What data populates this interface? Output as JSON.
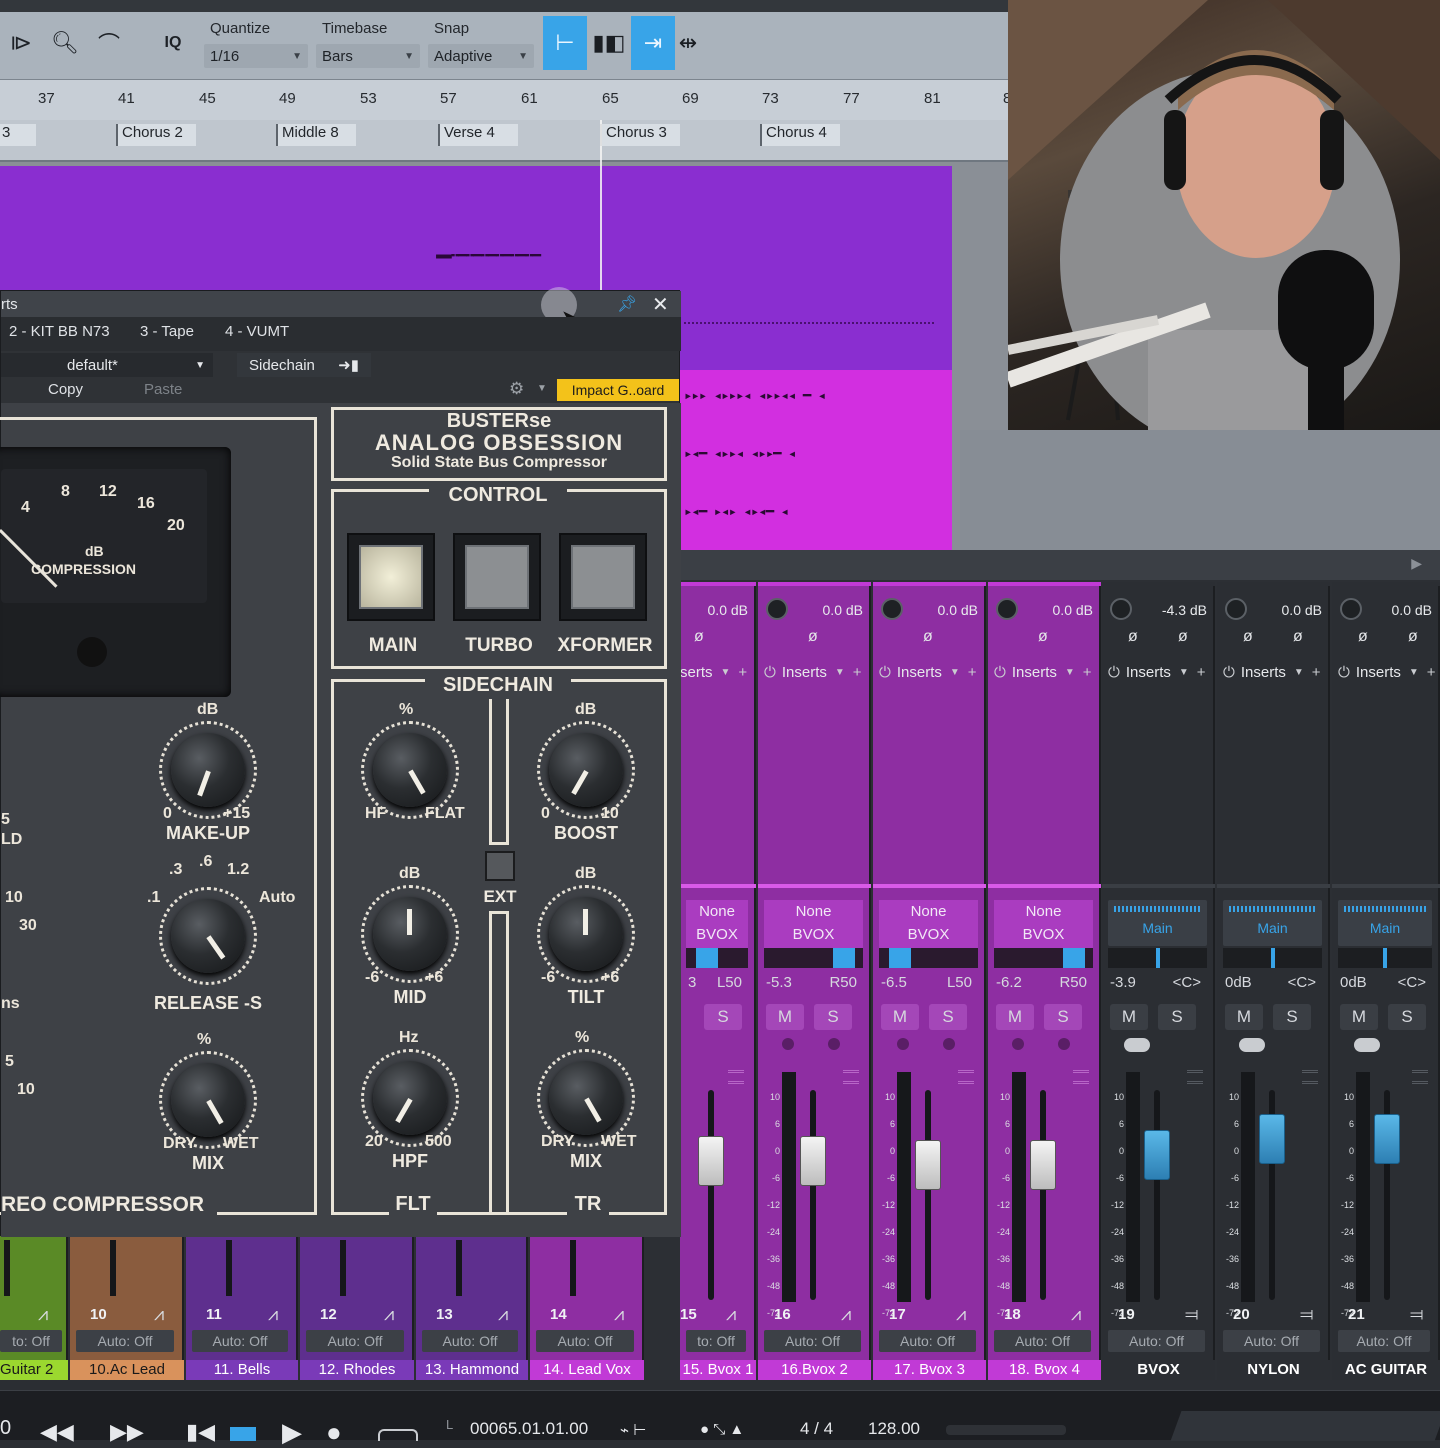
{
  "toolbar": {
    "quantize_label": "Quantize",
    "quantize_value": "1/16",
    "timebase_label": "Timebase",
    "timebase_value": "Bars",
    "snap_label": "Snap",
    "snap_value": "Adaptive",
    "iq_label": "IQ"
  },
  "ruler": {
    "bars": [
      "37",
      "41",
      "45",
      "49",
      "53",
      "57",
      "61",
      "65",
      "69",
      "73",
      "77",
      "81",
      "8"
    ]
  },
  "markers": [
    {
      "label": "3"
    },
    {
      "label": "Chorus 2"
    },
    {
      "label": "Middle 8"
    },
    {
      "label": "Verse 4"
    },
    {
      "label": "Chorus 3"
    },
    {
      "label": "Chorus 4"
    }
  ],
  "plugin": {
    "title": "rts",
    "tabs": [
      "2 - KIT BB N73",
      "3 - Tape",
      "4 - VUMT"
    ],
    "preset": "default*",
    "sidechain_label": "Sidechain",
    "copy_label": "Copy",
    "paste_label": "Paste",
    "preset_chip": "Impact G..oard",
    "brand_line1": "BUSTERse",
    "brand_line2": "ANALOG OBSESSION",
    "brand_line3": "Solid State Bus Compressor",
    "control_title": "CONTROL",
    "control_buttons": [
      "MAIN",
      "TURBO",
      "XFORMER"
    ],
    "sidechain_title": "SIDECHAIN",
    "meter_label_1": "dB",
    "meter_label_2": "COMPRESSION",
    "meter_ticks": [
      "4",
      "8",
      "12",
      "16",
      "20"
    ],
    "knobs": {
      "makeup": {
        "unit": "dB",
        "min": "0",
        "max": "+15",
        "name": "MAKE-UP"
      },
      "release": {
        "t1": ".3",
        "t2": ".6",
        "t3": "1.2",
        "t0": ".1",
        "auto": "Auto",
        "name": "RELEASE -S"
      },
      "mix_left": {
        "unit": "%",
        "min": "DRY",
        "max": "WET",
        "name": "MIX"
      },
      "hf": {
        "unit": "%",
        "min": "HF",
        "max": "FLAT"
      },
      "mid": {
        "unit": "dB",
        "min": "-6",
        "max": "+6",
        "name": "MID"
      },
      "hpf": {
        "unit": "Hz",
        "min": "20",
        "max": "500",
        "name": "HPF"
      },
      "boost": {
        "unit": "dB",
        "min": "0",
        "max": "10",
        "name": "BOOST"
      },
      "tilt": {
        "unit": "dB",
        "min": "-6",
        "max": "+6",
        "name": "TILT"
      },
      "mix_right": {
        "unit": "%",
        "min": "DRY",
        "max": "WET",
        "name": "MIX"
      }
    },
    "ext_label": "EXT",
    "flt_label": "FLT",
    "tr_label": "TR",
    "bottom_title": "REO COMPRESSOR",
    "left_partial": {
      "a": "5",
      "b": "LD",
      "c": "10",
      "d": "30",
      "e": "ns",
      "f": "5",
      "g": "10"
    }
  },
  "mixer": {
    "channels": [
      {
        "num": "15",
        "vol": "0.0 dB",
        "send_top": "None",
        "send_bus": "BVOX",
        "vol_val": "3",
        "pan": "L50",
        "name": "15. Bvox 1",
        "color": "#c13ad6"
      },
      {
        "num": "16",
        "vol": "0.0 dB",
        "send_top": "None",
        "send_bus": "BVOX",
        "vol_val": "-5.3",
        "pan": "R50",
        "name": "16.Bvox 2",
        "color": "#c13ad6"
      },
      {
        "num": "17",
        "vol": "0.0 dB",
        "send_top": "None",
        "send_bus": "BVOX",
        "vol_val": "-6.5",
        "pan": "L50",
        "name": "17. Bvox 3",
        "color": "#c13ad6"
      },
      {
        "num": "18",
        "vol": "0.0 dB",
        "send_top": "None",
        "send_bus": "BVOX",
        "vol_val": "-6.2",
        "pan": "R50",
        "name": "18. Bvox 4",
        "color": "#c13ad6"
      },
      {
        "num": "19",
        "vol": "-4.3 dB",
        "send_top": "",
        "send_bus": "Main",
        "vol_val": "-3.9",
        "pan": "<C>",
        "name": "BVOX",
        "color": "#2b2e33"
      },
      {
        "num": "20",
        "vol": "0.0 dB",
        "send_top": "",
        "send_bus": "Main",
        "vol_val": "0dB",
        "pan": "<C>",
        "name": "NYLON",
        "color": "#2b2e33"
      },
      {
        "num": "21",
        "vol": "0.0 dB",
        "send_top": "",
        "send_bus": "Main",
        "vol_val": "0dB",
        "pan": "<C>",
        "name": "AC GUITAR",
        "color": "#2b2e33"
      }
    ],
    "inserts_label": "Inserts",
    "inserts_partial": "serts",
    "auto_label": "Auto: Off",
    "auto_partial": "to: Off",
    "mute_label": "M",
    "solo_label": "S",
    "phase_symbol": "ø",
    "scale": [
      "10",
      "6",
      "0",
      "-6",
      "-12",
      "-24",
      "-36",
      "-48",
      "-72"
    ],
    "left_channels": [
      {
        "num": "",
        "name": "Guitar 2",
        "color": "#9bd82f",
        "text": "#1a1a1a"
      },
      {
        "num": "10",
        "name": "10.Ac Lead",
        "color": "#d9925c",
        "text": "#1a1a1a"
      },
      {
        "num": "11",
        "name": "11. Bells",
        "color": "#7a3ab8",
        "text": "#ffffff"
      },
      {
        "num": "12",
        "name": "12. Rhodes",
        "color": "#7a3ab8",
        "text": "#ffffff"
      },
      {
        "num": "13",
        "name": "13. Hammond",
        "color": "#7a3ab8",
        "text": "#ffffff"
      },
      {
        "num": "14",
        "name": "14. Lead Vox",
        "color": "#c13ad6",
        "text": "#ffffff"
      }
    ]
  },
  "transport": {
    "left_digit": "0",
    "time_label": "L",
    "time": "00065.01.01.00",
    "signature": "4 / 4",
    "tempo": "128.00"
  },
  "colors": {
    "accent_blue": "#38a4e8",
    "purple": "#8a2ed0",
    "magenta": "#d22fe0",
    "preset_chip": "#f3c21a"
  }
}
